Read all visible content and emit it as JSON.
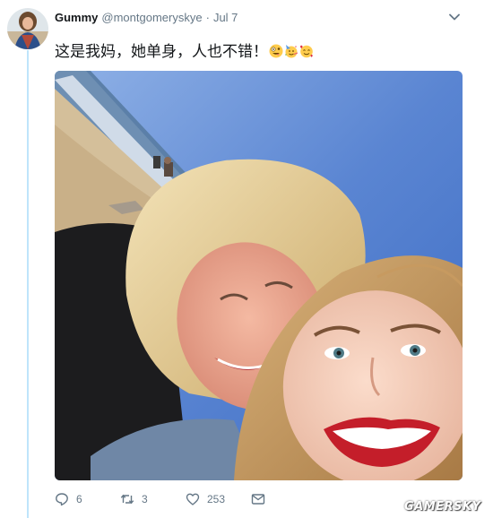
{
  "tweet": {
    "author_name": "Gummy",
    "handle": "@montgomeryskye",
    "separator": "·",
    "date": "Jul 7",
    "text": "这是我妈，她单身，人也不错！",
    "emojis": [
      "zany-face",
      "partying-face",
      "smiling-face-with-hearts"
    ]
  },
  "actions": {
    "replies": "6",
    "retweets": "3",
    "likes": "253"
  },
  "colors": {
    "thread_line": "#bfe5fb",
    "secondary_text": "#657786",
    "sky": "#4a78c8",
    "lipstick": "#c41e2a"
  },
  "watermark": "GAMERSKY"
}
